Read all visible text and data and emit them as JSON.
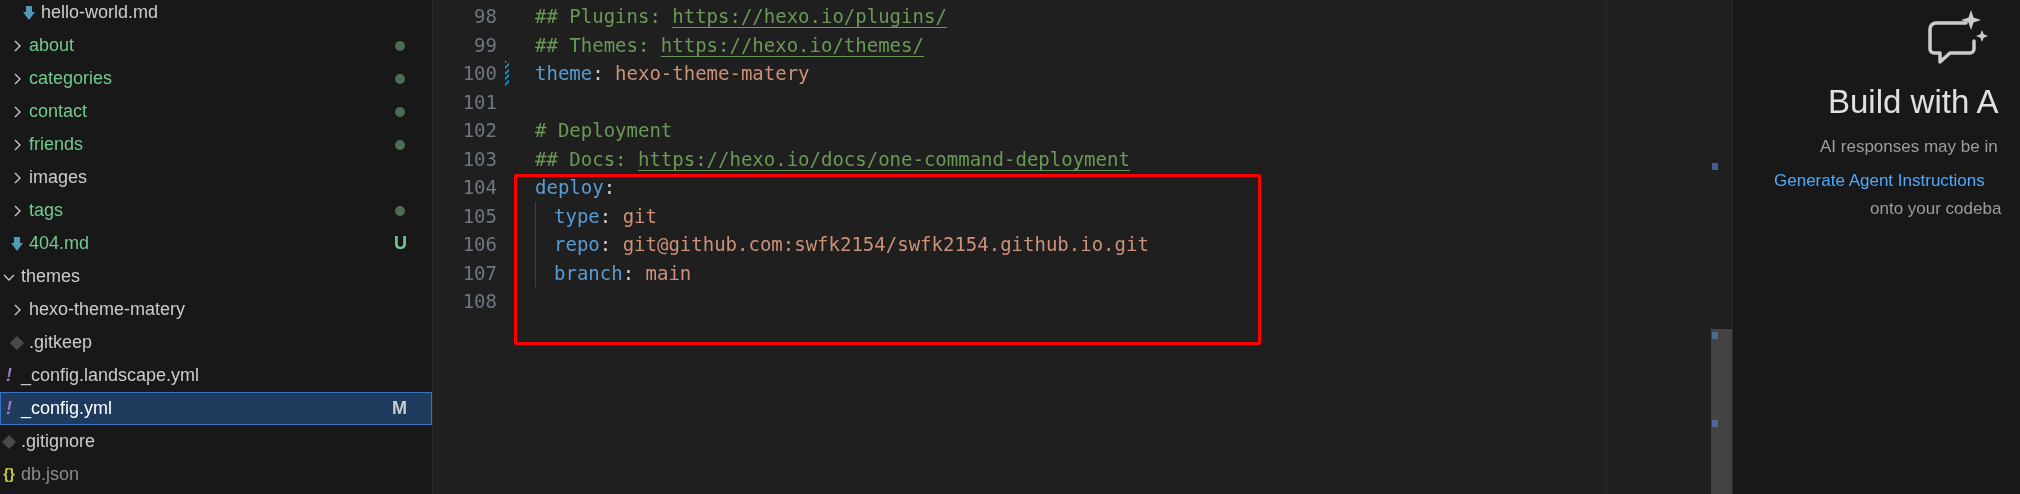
{
  "sidebar": {
    "tree": [
      {
        "children": [
          {
            "children": [
              {
                "kind": "markdown",
                "label": "hello-world.md",
                "selected": false
              }
            ]
          },
          {
            "kind": "folder",
            "label": "about",
            "expanded": false,
            "color": "#73c991",
            "dot": {
              "color": "#4f6b55"
            },
            "selected": false
          },
          {
            "kind": "folder",
            "label": "categories",
            "expanded": false,
            "color": "#73c991",
            "dot": {
              "color": "#4f6b55"
            },
            "selected": false
          },
          {
            "kind": "folder",
            "label": "contact",
            "expanded": false,
            "color": "#73c991",
            "dot": {
              "color": "#4f6b55"
            },
            "selected": false
          },
          {
            "kind": "folder",
            "label": "friends",
            "expanded": false,
            "color": "#73c991",
            "dot": {
              "color": "#4f6b55"
            },
            "selected": false
          },
          {
            "kind": "folder",
            "label": "images",
            "expanded": false,
            "selected": false
          },
          {
            "kind": "folder",
            "label": "tags",
            "expanded": false,
            "color": "#73c991",
            "dot": {
              "color": "#4f6b55"
            },
            "selected": false
          },
          {
            "kind": "markdown",
            "label": "404.md",
            "color": "#73c991",
            "badge": "U",
            "selected": false
          }
        ]
      },
      {
        "kind": "folder",
        "label": "themes",
        "expanded": true,
        "selected": false,
        "children": [
          {
            "kind": "folder",
            "label": "hexo-theme-matery",
            "expanded": false,
            "selected": false
          },
          {
            "kind": "gitfile",
            "label": ".gitkeep",
            "selected": false
          }
        ]
      },
      {
        "kind": "yaml",
        "glyph": "!",
        "label": "_config.landscape.yml",
        "selected": false
      },
      {
        "kind": "yaml",
        "glyph": "!",
        "label": "_config.yml",
        "badge": "M",
        "selected": true
      },
      {
        "kind": "gitfile",
        "label": ".gitignore",
        "selected": false
      },
      {
        "kind": "json",
        "glyph": "{}",
        "label": "db.json",
        "color": "#8c8c8c",
        "selected": false
      }
    ]
  },
  "editor": {
    "lines": [
      {
        "number": "98",
        "tokens": [
          {
            "kind": "comment",
            "text": "## Plugins: "
          },
          {
            "kind": "link",
            "text": "https://hexo.io/plugins/"
          }
        ]
      },
      {
        "number": "99",
        "tokens": [
          {
            "kind": "comment",
            "text": "## Themes: "
          },
          {
            "kind": "link",
            "text": "https://hexo.io/themes/"
          }
        ]
      },
      {
        "number": "100",
        "changed": true,
        "tokens": [
          {
            "kind": "key",
            "text": "theme"
          },
          {
            "kind": "punct",
            "text": ": "
          },
          {
            "kind": "value",
            "text": "hexo-theme-matery"
          }
        ]
      },
      {
        "number": "101"
      },
      {
        "number": "102",
        "tokens": [
          {
            "kind": "comment",
            "text": "# Deployment"
          }
        ]
      },
      {
        "number": "103",
        "tokens": [
          {
            "kind": "comment",
            "text": "## Docs: "
          },
          {
            "kind": "link",
            "text": "https://hexo.io/docs/one-command-deployment"
          }
        ]
      },
      {
        "number": "104",
        "tokens": [
          {
            "kind": "key",
            "text": "deploy"
          },
          {
            "kind": "punct",
            "text": ":"
          }
        ]
      },
      {
        "number": "105",
        "indented": true,
        "tokens": [
          {
            "kind": "key",
            "text": "type"
          },
          {
            "kind": "punct",
            "text": ": "
          },
          {
            "kind": "value",
            "text": "git"
          }
        ]
      },
      {
        "number": "106",
        "indented": true,
        "tokens": [
          {
            "kind": "key",
            "text": "repo"
          },
          {
            "kind": "punct",
            "text": ": "
          },
          {
            "kind": "value",
            "text": "git@github.com:swfk2154/swfk2154.github.io.git"
          }
        ]
      },
      {
        "number": "107",
        "indented": true,
        "tokens": [
          {
            "kind": "key",
            "text": "branch"
          },
          {
            "kind": "punct",
            "text": ": "
          },
          {
            "kind": "value",
            "text": "main"
          }
        ]
      },
      {
        "number": "108"
      }
    ]
  },
  "chat_panel": {
    "title": "Build with A",
    "note": "AI responses may be in",
    "link": "Generate Agent Instructions",
    "text": "onto your codeba"
  }
}
